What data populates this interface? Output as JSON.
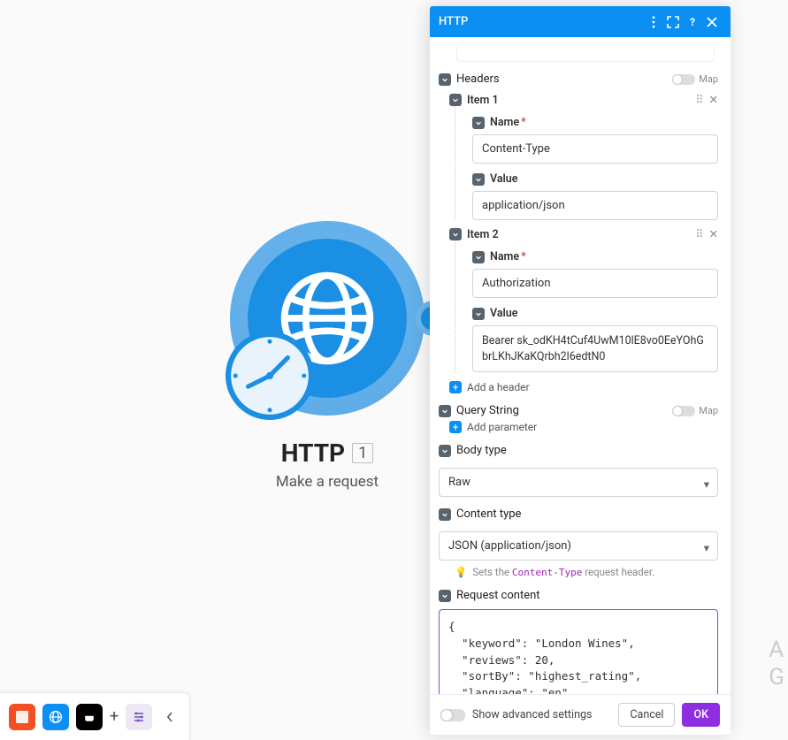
{
  "node": {
    "title": "HTTP",
    "badge": "1",
    "subtitle": "Make a request"
  },
  "panel": {
    "title": "HTTP"
  },
  "headers": {
    "label": "Headers",
    "map": "Map",
    "items": [
      {
        "title": "Item 1",
        "name_label": "Name",
        "name_value": "Content-Type",
        "value_label": "Value",
        "value_value": "application/json"
      },
      {
        "title": "Item 2",
        "name_label": "Name",
        "name_value": "Authorization",
        "value_label": "Value",
        "value_value": "Bearer sk_odKH4tCuf4UwM10lE8vo0EeYOhGbrLKhJKaKQrbh2l6edtN0"
      }
    ],
    "add": "Add a header"
  },
  "query": {
    "label": "Query String",
    "map": "Map",
    "add": "Add parameter"
  },
  "body_type": {
    "label": "Body type",
    "value": "Raw"
  },
  "content_type": {
    "label": "Content type",
    "value": "JSON (application/json)",
    "hint_pre": "Sets the ",
    "hint_code": "Content-Type",
    "hint_post": " request header."
  },
  "request_content": {
    "label": "Request content",
    "value": "{\n  \"keyword\": \"London Wines\",\n  \"reviews\": 20,\n  \"sortBy\": \"highest_rating\",\n  \"language\": \"en\"\n}"
  },
  "footer": {
    "advanced": "Show advanced settings",
    "cancel": "Cancel",
    "ok": "OK"
  },
  "rt": {
    "a": "A",
    "g": "G"
  }
}
